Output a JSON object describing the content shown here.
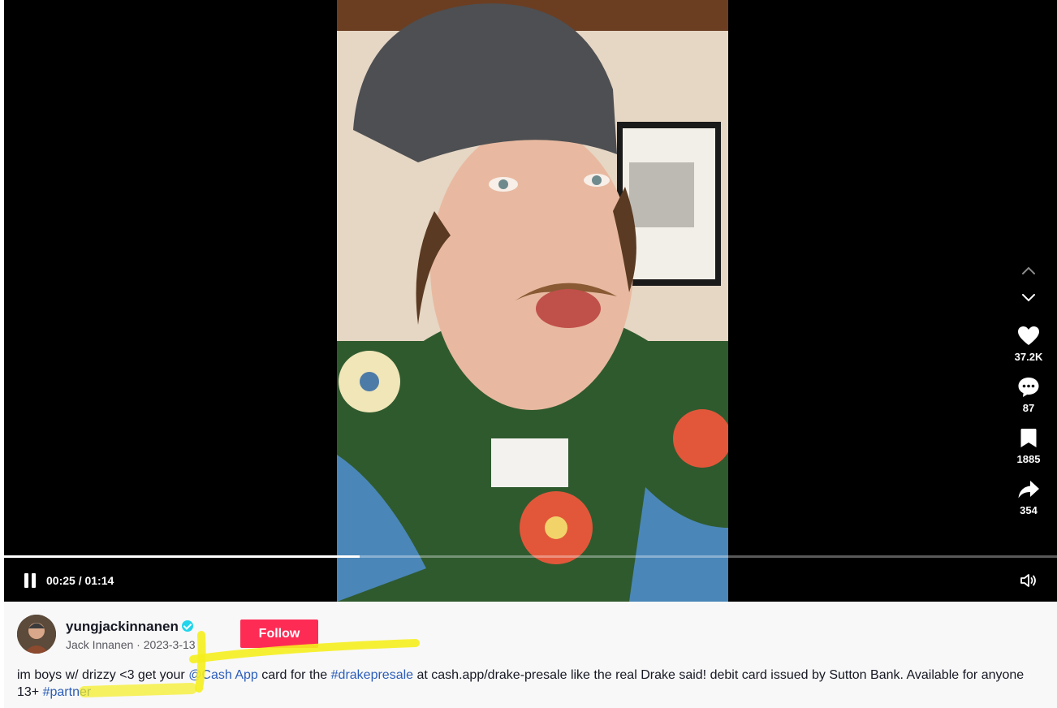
{
  "player": {
    "time_display": "00:25 / 01:14",
    "progress_fraction": 0.338
  },
  "actions": {
    "likes": "37.2K",
    "comments": "87",
    "saves": "1885",
    "shares": "354"
  },
  "author": {
    "username": "yungjackinnanen",
    "display_name": "Jack Innanen",
    "date": "2023-3-13",
    "separator": " · ",
    "verified": true
  },
  "follow_label": "Follow",
  "caption": {
    "part1": "im boys w/ drizzy <3 get your ",
    "mention": "@Cash App",
    "part2": " card for the ",
    "hashtag1": "#drakepresale",
    "part3": " at cash.app/drake-presale like the real Drake said! debit card issued by Sutton Bank. Available for anyone 13+ ",
    "hashtag2": "#partner"
  },
  "icons": [
    "pause-icon",
    "volume-icon",
    "chevron-up-icon",
    "chevron-down-icon",
    "heart-icon",
    "comment-icon",
    "bookmark-icon",
    "share-icon",
    "verified-badge-icon"
  ],
  "colors": {
    "follow_button": "#fe2c55",
    "link": "#2b5db9",
    "verified": "#20d5ec",
    "highlighter": "#f5ee1e"
  }
}
